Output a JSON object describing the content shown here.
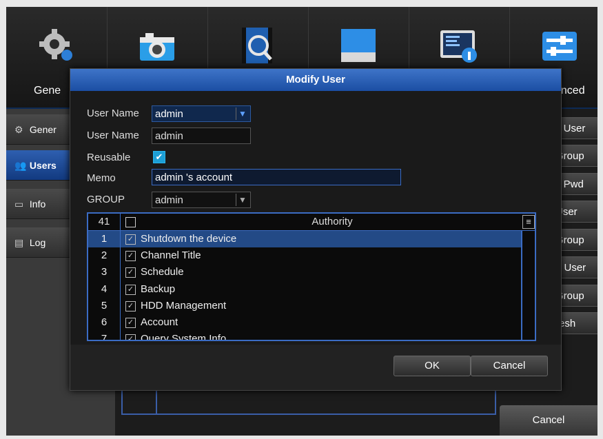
{
  "toolbar": {
    "tabs": [
      {
        "label": "Gene",
        "icon": "gear-icon"
      },
      {
        "label": "",
        "icon": "camera-icon"
      },
      {
        "label": "",
        "icon": "video-search-icon"
      },
      {
        "label": "",
        "icon": "hdd-icon"
      },
      {
        "label": "",
        "icon": "system-info-icon"
      },
      {
        "label": "anced",
        "icon": "sliders-icon"
      }
    ]
  },
  "sidebar": {
    "items": [
      {
        "label": "Gener",
        "icon": "gear-icon"
      },
      {
        "label": "Users",
        "icon": "users-icon"
      },
      {
        "label": "Info",
        "icon": "info-icon"
      },
      {
        "label": "Log",
        "icon": "log-icon"
      }
    ]
  },
  "right_buttons": [
    "y User",
    "Group",
    "y Pwd",
    "User",
    "Group",
    "e User",
    "Group",
    "resh"
  ],
  "background": {
    "cancel_label": "Cancel"
  },
  "dialog": {
    "title": "Modify User",
    "user_name_label": "User Name",
    "user_name_value": "admin",
    "user_name2_label": "User Name",
    "user_name2_value": "admin",
    "reusable_label": "Reusable",
    "reusable_checked": true,
    "memo_label": "Memo",
    "memo_value": "admin 's account",
    "group_label": "GROUP",
    "group_value": "admin",
    "table": {
      "count": "41",
      "header": "Authority",
      "rows": [
        {
          "num": "1",
          "label": "Shutdown the device"
        },
        {
          "num": "2",
          "label": "Channel Title"
        },
        {
          "num": "3",
          "label": "Schedule"
        },
        {
          "num": "4",
          "label": "Backup"
        },
        {
          "num": "5",
          "label": "HDD Management"
        },
        {
          "num": "6",
          "label": "Account"
        },
        {
          "num": "7",
          "label": "Query System Info"
        }
      ]
    },
    "ok_label": "OK",
    "cancel_label": "Cancel"
  },
  "colors": {
    "accent": "#1b4ea3",
    "selection": "#234a86",
    "checkbox": "#1d9fd6"
  }
}
